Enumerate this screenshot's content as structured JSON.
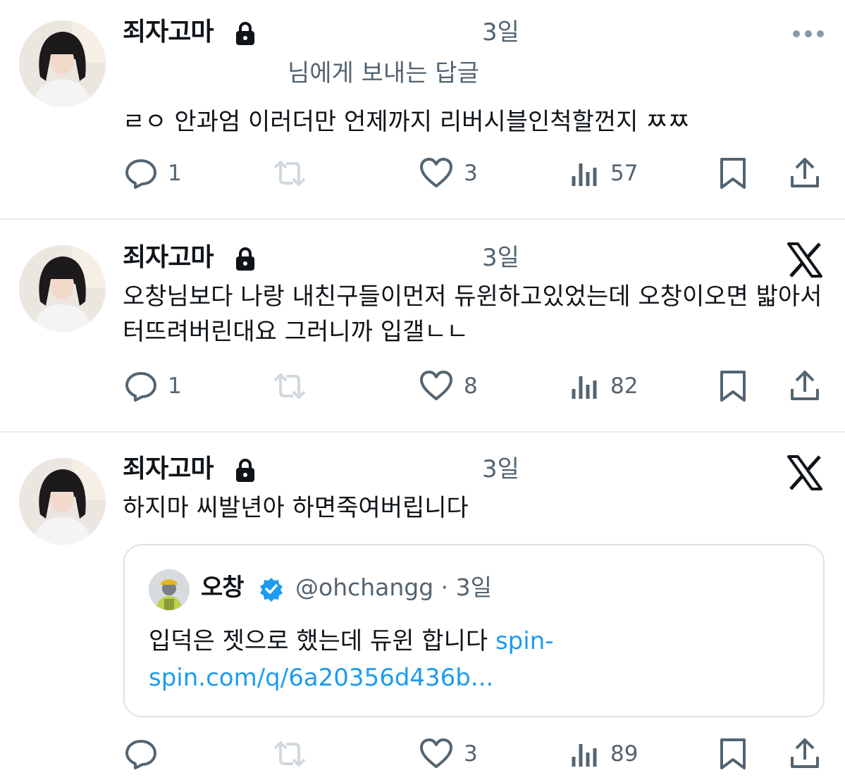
{
  "tweets": [
    {
      "author": "죄자고마",
      "time": "3일",
      "reply_to": "님에게 보내는 답글",
      "text": "ㄹㅇ 안과엄 이러더만 언제까지 리버시블인척할껀지 ㅉㅉ",
      "counts": {
        "replies": "1",
        "retweets": "",
        "likes": "3",
        "views": "57"
      }
    },
    {
      "author": "죄자고마",
      "time": "3일",
      "text": "오창님보다 나랑 내친구들이먼저 듀윈하고있었는데 오창이오면 밟아서터뜨려버린대요 그러니까 입갤ㄴㄴ",
      "counts": {
        "replies": "1",
        "retweets": "",
        "likes": "8",
        "views": "82"
      }
    },
    {
      "author": "죄자고마",
      "time": "3일",
      "text": "하지마 씨발년아 하면죽여버립니다",
      "quote": {
        "name": "오창",
        "handle": "@ohchangg · 3일",
        "text": "입덕은 젯으로 했는데 듀윈 합니다 ",
        "link": "spin-spin.com/q/6a20356d436b..."
      },
      "counts": {
        "replies": "",
        "retweets": "",
        "likes": "3",
        "views": "89"
      }
    }
  ],
  "icons": [
    "lock-icon",
    "more-icon",
    "x-logo-icon",
    "reply-icon",
    "retweet-icon",
    "like-icon",
    "views-icon",
    "bookmark-icon",
    "share-icon",
    "verified-badge-icon"
  ],
  "colors": {
    "text": "#0f1419",
    "secondary": "#536471",
    "link": "#1d9bf0",
    "retweet_disabled": "#cfd9de",
    "verified": "#1d9bf0"
  }
}
